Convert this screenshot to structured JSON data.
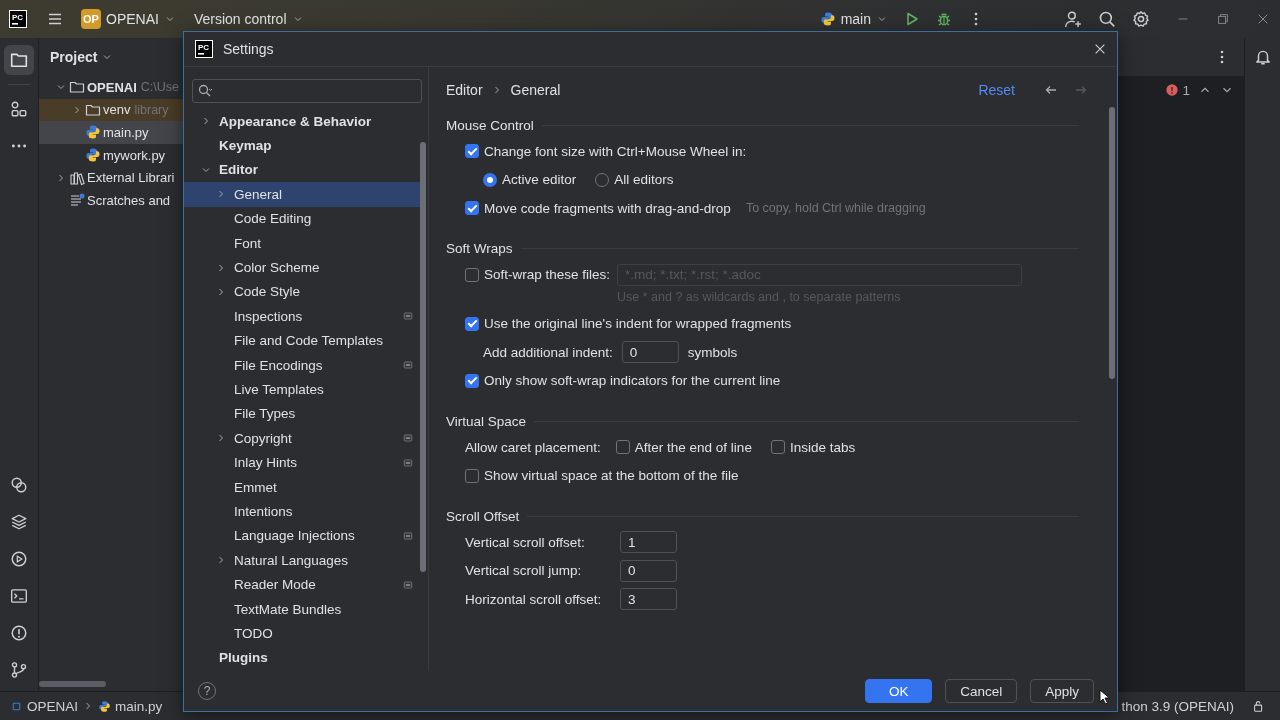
{
  "topbar": {
    "logo": "PC",
    "project_badge": "OP",
    "project": "OPENAI",
    "vcs": "Version control",
    "run_config": "main"
  },
  "tool_window": {
    "title": "Project",
    "tree": [
      {
        "label": "OPENAI",
        "detail": "C:\\Use",
        "kind": "folder",
        "expanded": true,
        "selected": false,
        "excluded": false,
        "children": [
          {
            "label": "venv",
            "detail": "library",
            "kind": "folder",
            "expanded": false,
            "selected": false,
            "excluded": true
          },
          {
            "label": "main.py",
            "kind": "python",
            "selected": true,
            "excluded": false
          },
          {
            "label": "mywork.py",
            "kind": "python",
            "selected": false,
            "excluded": false
          }
        ]
      },
      {
        "label": "External Librari",
        "kind": "libraries",
        "expanded": false,
        "selected": false,
        "excluded": false
      },
      {
        "label": "Scratches and",
        "kind": "scratches",
        "selected": false,
        "excluded": false
      }
    ]
  },
  "editor": {
    "problems": "1"
  },
  "dialog": {
    "logo": "PC",
    "title": "Settings",
    "tree": [
      {
        "label": "Appearance & Behavior",
        "expanded": false,
        "selected": false,
        "project_level": false
      },
      {
        "label": "Keymap",
        "selected": false,
        "project_level": false
      },
      {
        "label": "Editor",
        "expanded": true,
        "selected": false,
        "project_level": false,
        "children": [
          {
            "label": "General",
            "expanded": false,
            "selected": true,
            "project_level": false
          },
          {
            "label": "Code Editing",
            "selected": false,
            "project_level": false
          },
          {
            "label": "Font",
            "selected": false,
            "project_level": false
          },
          {
            "label": "Color Scheme",
            "expanded": false,
            "selected": false,
            "project_level": false
          },
          {
            "label": "Code Style",
            "expanded": false,
            "selected": false,
            "project_level": false
          },
          {
            "label": "Inspections",
            "selected": false,
            "project_level": true
          },
          {
            "label": "File and Code Templates",
            "selected": false,
            "project_level": false
          },
          {
            "label": "File Encodings",
            "selected": false,
            "project_level": true
          },
          {
            "label": "Live Templates",
            "selected": false,
            "project_level": false
          },
          {
            "label": "File Types",
            "selected": false,
            "project_level": false
          },
          {
            "label": "Copyright",
            "expanded": false,
            "selected": false,
            "project_level": true
          },
          {
            "label": "Inlay Hints",
            "selected": false,
            "project_level": true
          },
          {
            "label": "Emmet",
            "selected": false,
            "project_level": false
          },
          {
            "label": "Intentions",
            "selected": false,
            "project_level": false
          },
          {
            "label": "Language Injections",
            "selected": false,
            "project_level": true
          },
          {
            "label": "Natural Languages",
            "expanded": false,
            "selected": false,
            "project_level": false
          },
          {
            "label": "Reader Mode",
            "selected": false,
            "project_level": true
          },
          {
            "label": "TextMate Bundles",
            "selected": false,
            "project_level": false
          },
          {
            "label": "TODO",
            "selected": false,
            "project_level": false
          }
        ]
      },
      {
        "label": "Plugins",
        "selected": false,
        "project_level": false
      }
    ],
    "breadcrumb": [
      "Editor",
      "General"
    ],
    "reset": "Reset",
    "sections": [
      {
        "title": "Mouse Control",
        "rows": [
          {
            "kind": "checkbox",
            "label": "Change font size with Ctrl+Mouse Wheel in:",
            "checked": true
          },
          {
            "kind": "radios",
            "options": [
              {
                "label": "Active editor",
                "selected": true
              },
              {
                "label": "All editors",
                "selected": false
              }
            ]
          },
          {
            "kind": "checkbox",
            "label": "Move code fragments with drag-and-drop",
            "checked": true,
            "hint": "To copy, hold Ctrl while dragging"
          }
        ]
      },
      {
        "title": "Soft Wraps",
        "rows": [
          {
            "kind": "checkbox",
            "label": "Soft-wrap these files:",
            "checked": false,
            "field": {
              "placeholder": "*.md; *.txt; *.rst; *.adoc",
              "note": "Use * and ? as wildcards and , to separate patterns"
            }
          },
          {
            "kind": "checkbox",
            "label": "Use the original line's indent for wrapped fragments",
            "checked": true
          },
          {
            "kind": "sub_number",
            "label": "Add additional indent:",
            "value": "0",
            "suffix": "symbols"
          },
          {
            "kind": "checkbox",
            "label": "Only show soft-wrap indicators for the current line",
            "checked": true
          }
        ]
      },
      {
        "title": "Virtual Space",
        "rows": [
          {
            "kind": "checkgroup",
            "label": "Allow caret placement:",
            "options": [
              {
                "label": "After the end of line",
                "checked": false
              },
              {
                "label": "Inside tabs",
                "checked": false
              }
            ]
          },
          {
            "kind": "checkbox",
            "label": "Show virtual space at the bottom of the file",
            "checked": false
          }
        ]
      },
      {
        "title": "Scroll Offset",
        "rows": [
          {
            "kind": "number",
            "label": "Vertical scroll offset:",
            "value": "1"
          },
          {
            "kind": "number",
            "label": "Vertical scroll jump:",
            "value": "0"
          },
          {
            "kind": "number",
            "label": "Horizontal scroll offset:",
            "value": "3"
          }
        ]
      }
    ],
    "help": "?",
    "buttons": [
      {
        "label": "OK",
        "kind": "primary"
      },
      {
        "label": "Cancel",
        "kind": "secondary"
      },
      {
        "label": "Apply",
        "kind": "secondary"
      }
    ]
  },
  "status_bar": {
    "path": [
      "OPENAI",
      "main.py"
    ],
    "interpreter": "thon 3.9 (OPENAI)"
  }
}
